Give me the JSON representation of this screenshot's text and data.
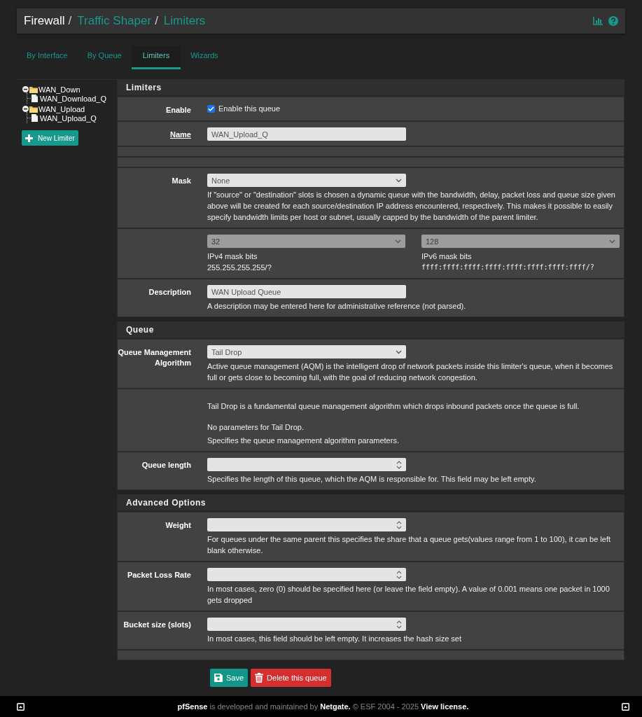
{
  "breadcrumb": [
    {
      "label": "Firewall",
      "link": false,
      "separator": "/"
    },
    {
      "label": "Traffic Shaper",
      "link": true,
      "separator": "/"
    },
    {
      "label": "Limiters",
      "link": true
    }
  ],
  "tabs": [
    {
      "label": "By Interface",
      "selected": false
    },
    {
      "label": "By Queue",
      "selected": false
    },
    {
      "label": "Limiters",
      "selected": true
    },
    {
      "label": "Wizards",
      "selected": false
    }
  ],
  "tree": [
    {
      "label": "WAN_Down",
      "expanded": true,
      "children": [
        {
          "label": "WAN_Download_Q"
        }
      ]
    },
    {
      "label": "WAN_Upload",
      "expanded": true,
      "children": [
        {
          "label": "WAN_Upload_Q"
        }
      ]
    }
  ],
  "new_limiter_button": "New Limiter",
  "sections": [
    {
      "title": "Limiters",
      "rows": [
        {
          "kind": "checkbox",
          "label": "Enable",
          "checked": true,
          "text": "Enable this queue"
        },
        {
          "kind": "text",
          "label": "Name",
          "required": true,
          "value": "WAN_Upload_Q"
        },
        {
          "kind": "blank"
        },
        {
          "kind": "blank"
        },
        {
          "kind": "select",
          "label": "Mask",
          "value": "None",
          "disabled": false,
          "help": "If \"source\" or \"destination\" slots is chosen a dynamic queue with the bandwidth, delay, packet loss and queue size given above will be created for each source/destination IP address encountered, respectively. This makes it possible to easily specify bandwidth limits per host or subnet, usually capped by the bandwidth of the parent limiter."
        },
        {
          "kind": "dual_select",
          "items": [
            {
              "value": "32",
              "disabled": true,
              "caption": "IPv4 mask bits",
              "note": "255.255.255.255/?",
              "mono": false
            },
            {
              "value": "128",
              "disabled": true,
              "caption": "IPv6 mask bits",
              "note": "ffff:ffff:ffff:ffff:ffff:ffff:ffff:ffff/?",
              "mono": true
            }
          ]
        },
        {
          "kind": "text",
          "label": "Description",
          "required": false,
          "value": "WAN Upload Queue",
          "help": "A description may be entered here for administrative reference (not parsed)."
        }
      ]
    },
    {
      "title": "Queue",
      "rows": [
        {
          "kind": "select",
          "label": "Queue Management Algorithm",
          "value": "Tail Drop",
          "disabled": false,
          "help": "Active queue management (AQM) is the intelligent drop of network packets inside this limiter's queue, when it becomes full or gets close to becoming full, with the goal of reducing network congestion."
        },
        {
          "kind": "info",
          "paragraphs": [
            "Tail Drop is a fundamental queue management algorithm which drops inbound packets once the queue is full.",
            "No parameters for Tail Drop."
          ],
          "help": "Specifies the queue management algorithm parameters."
        },
        {
          "kind": "number",
          "label": "Queue length",
          "help": "Specifies the length of this queue, which the AQM is responsible for. This field may be left empty."
        }
      ]
    },
    {
      "title": "Advanced Options",
      "rows": [
        {
          "kind": "number",
          "label": "Weight",
          "help": "For queues under the same parent this specifies the share that a queue gets(values range from 1 to 100), it can be left blank otherwise."
        },
        {
          "kind": "number",
          "label": "Packet Loss Rate",
          "help": "In most cases, zero (0) should be specified here (or leave the field empty). A value of 0.001 means one packet in 1000 gets dropped"
        },
        {
          "kind": "number",
          "label": "Bucket size (slots)",
          "help": "In most cases, this field should be left empty. It increases the hash size set"
        },
        {
          "kind": "blank"
        }
      ]
    }
  ],
  "buttons": [
    {
      "kind": "save",
      "label": "Save"
    },
    {
      "kind": "delete",
      "label": "Delete this queue"
    }
  ],
  "footer": "**pfSense** is developed and maintained by **Netgate.** © ESF 2004 - 2025 **View license.**"
}
